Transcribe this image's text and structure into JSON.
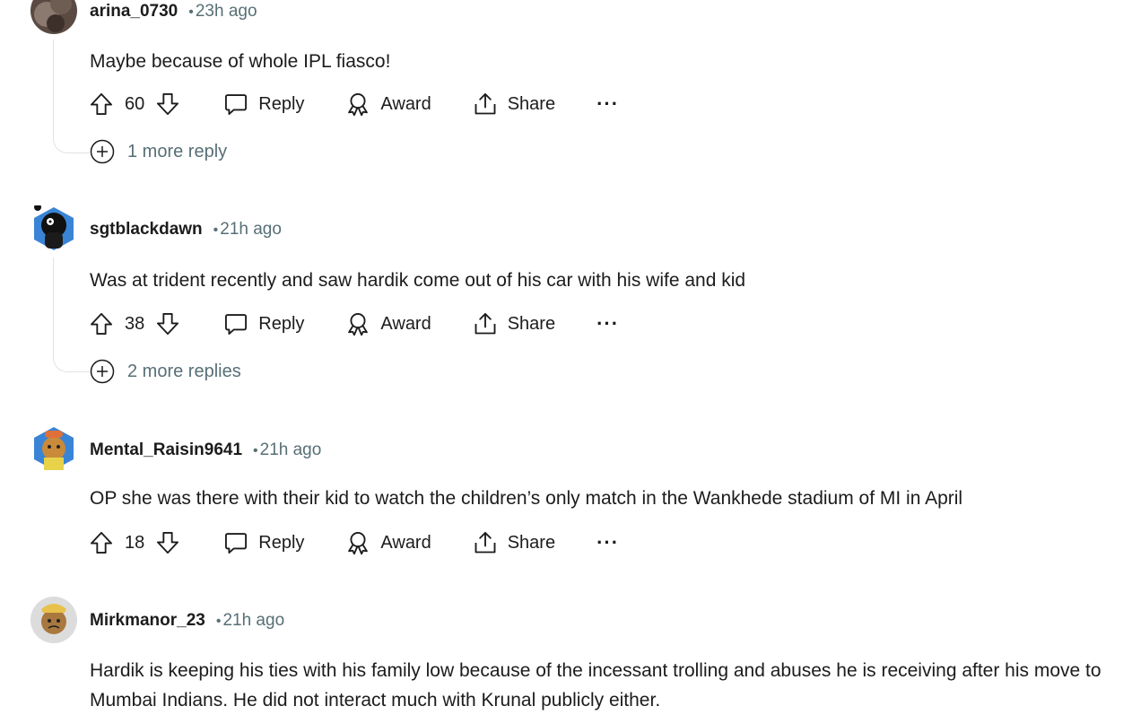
{
  "comments": [
    {
      "username": "arina_0730",
      "separator": "•",
      "time": "23h ago",
      "text": "Maybe because of whole IPL fiasco!",
      "votes": "60",
      "reply_label": "Reply",
      "award_label": "Award",
      "share_label": "Share",
      "more_label": "···",
      "more_replies": "1 more reply"
    },
    {
      "username": "sgtblackdawn",
      "separator": "•",
      "time": "21h ago",
      "text": "Was at trident recently and saw hardik come out of his car with his wife and kid",
      "votes": "38",
      "reply_label": "Reply",
      "award_label": "Award",
      "share_label": "Share",
      "more_label": "···",
      "more_replies": "2 more replies"
    },
    {
      "username": "Mental_Raisin9641",
      "separator": "•",
      "time": "21h ago",
      "text": "OP she was there with their kid to watch the children’s only match in the Wankhede stadium of MI in April",
      "votes": "18",
      "reply_label": "Reply",
      "award_label": "Award",
      "share_label": "Share",
      "more_label": "···"
    },
    {
      "username": "Mirkmanor_23",
      "separator": "•",
      "time": "21h ago",
      "text": "Hardik is keeping his ties with his family low because of the incessant trolling and abuses he is receiving after his move to Mumbai Indians. He did not interact much with Krunal publicly either."
    }
  ],
  "icons": {
    "upvote": "upvote-arrow-icon",
    "downvote": "downvote-arrow-icon",
    "reply": "speech-bubble-icon",
    "award": "award-ribbon-icon",
    "share": "share-upload-icon",
    "more": "ellipsis-icon",
    "expand": "plus-circle-icon"
  },
  "colors": {
    "text": "#1c1c1c",
    "meta": "#576f76",
    "thread_line": "#dfe3e6"
  }
}
